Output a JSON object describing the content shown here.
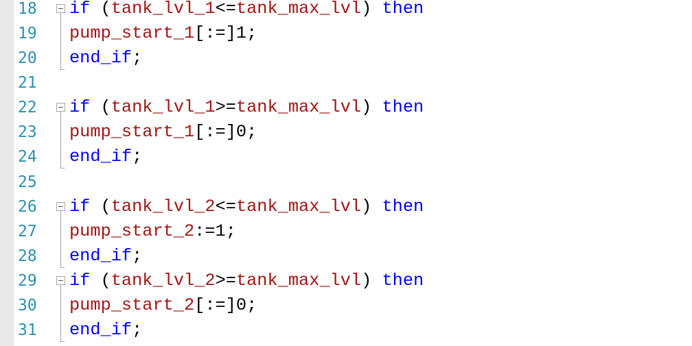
{
  "editor": {
    "lines": [
      {
        "number": "18",
        "fold": true,
        "tokens": [
          {
            "t": "if",
            "c": "kw"
          },
          {
            "t": " (",
            "c": "op"
          },
          {
            "t": "tank_lvl_1",
            "c": "id"
          },
          {
            "t": "<=",
            "c": "op"
          },
          {
            "t": "tank_max_lvl",
            "c": "id"
          },
          {
            "t": ") ",
            "c": "op"
          },
          {
            "t": "then",
            "c": "kw"
          }
        ]
      },
      {
        "number": "19",
        "tokens": [
          {
            "t": "pump_start_1",
            "c": "id"
          },
          {
            "t": "[:=]1;",
            "c": "op"
          }
        ]
      },
      {
        "number": "20",
        "fold_end": true,
        "tokens": [
          {
            "t": "end_if",
            "c": "kw"
          },
          {
            "t": ";",
            "c": "op"
          }
        ]
      },
      {
        "number": "21",
        "tokens": []
      },
      {
        "number": "22",
        "fold": true,
        "tokens": [
          {
            "t": "if",
            "c": "kw"
          },
          {
            "t": " (",
            "c": "op"
          },
          {
            "t": "tank_lvl_1",
            "c": "id"
          },
          {
            "t": ">=",
            "c": "op"
          },
          {
            "t": "tank_max_lvl",
            "c": "id"
          },
          {
            "t": ") ",
            "c": "op"
          },
          {
            "t": "then",
            "c": "kw"
          }
        ]
      },
      {
        "number": "23",
        "tokens": [
          {
            "t": "pump_start_1",
            "c": "id"
          },
          {
            "t": "[:=]0;",
            "c": "op"
          }
        ]
      },
      {
        "number": "24",
        "fold_end": true,
        "tokens": [
          {
            "t": "end_if",
            "c": "kw"
          },
          {
            "t": ";",
            "c": "op"
          }
        ]
      },
      {
        "number": "25",
        "tokens": []
      },
      {
        "number": "26",
        "fold": true,
        "tokens": [
          {
            "t": "if",
            "c": "kw"
          },
          {
            "t": " (",
            "c": "op"
          },
          {
            "t": "tank_lvl_2",
            "c": "id"
          },
          {
            "t": "<=",
            "c": "op"
          },
          {
            "t": "tank_max_lvl",
            "c": "id"
          },
          {
            "t": ") ",
            "c": "op"
          },
          {
            "t": "then",
            "c": "kw"
          }
        ]
      },
      {
        "number": "27",
        "tokens": [
          {
            "t": "pump_start_2",
            "c": "id"
          },
          {
            "t": ":=1;",
            "c": "op"
          }
        ]
      },
      {
        "number": "28",
        "fold_end": true,
        "tokens": [
          {
            "t": "end_if",
            "c": "kw"
          },
          {
            "t": ";",
            "c": "op"
          }
        ]
      },
      {
        "number": "29",
        "fold": true,
        "tokens": [
          {
            "t": "if",
            "c": "kw"
          },
          {
            "t": " (",
            "c": "op"
          },
          {
            "t": "tank_lvl_2",
            "c": "id"
          },
          {
            "t": ">=",
            "c": "op"
          },
          {
            "t": "tank_max_lvl",
            "c": "id"
          },
          {
            "t": ") ",
            "c": "op"
          },
          {
            "t": "then",
            "c": "kw"
          }
        ]
      },
      {
        "number": "30",
        "tokens": [
          {
            "t": "pump_start_2",
            "c": "id"
          },
          {
            "t": "[:=]0;",
            "c": "op"
          }
        ]
      },
      {
        "number": "31",
        "fold_end": true,
        "tokens": [
          {
            "t": "end_if",
            "c": "kw"
          },
          {
            "t": ";",
            "c": "op"
          }
        ]
      }
    ]
  },
  "colors": {
    "keyword": "#0000ff",
    "identifier": "#a31515",
    "operator": "#000000",
    "line_number": "#2b91af",
    "gutter_strip": "#e9e9e9"
  }
}
